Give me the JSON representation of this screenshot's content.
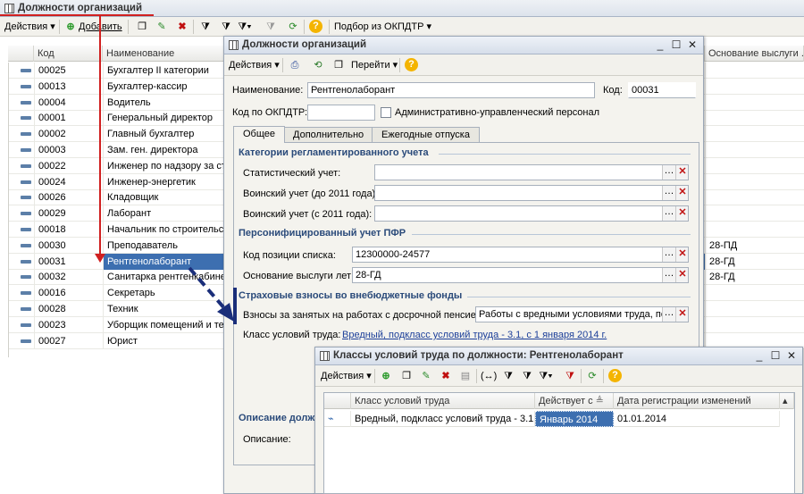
{
  "main": {
    "title": "Должности организаций",
    "toolbar": {
      "actions": "Действия",
      "add": "Добавить",
      "okpdtr": "Подбор из ОКПДТР"
    },
    "columns": {
      "code": "Код",
      "name": "Наименование",
      "seniority": "Основание выслуги ..."
    },
    "rows": [
      {
        "code": "00025",
        "name": "Бухгалтер II категории",
        "seniority": ""
      },
      {
        "code": "00013",
        "name": "Бухгалтер-кассир",
        "seniority": ""
      },
      {
        "code": "00004",
        "name": "Водитель",
        "seniority": ""
      },
      {
        "code": "00001",
        "name": "Генеральный директор",
        "seniority": ""
      },
      {
        "code": "00002",
        "name": "Главный бухгалтер",
        "seniority": ""
      },
      {
        "code": "00003",
        "name": "Зам. ген. директора",
        "seniority": ""
      },
      {
        "code": "00022",
        "name": "Инженер по надзору за стр",
        "seniority": ""
      },
      {
        "code": "00024",
        "name": "Инженер-энергетик",
        "seniority": ""
      },
      {
        "code": "00026",
        "name": "Кладовщик",
        "seniority": ""
      },
      {
        "code": "00029",
        "name": "Лаборант",
        "seniority": ""
      },
      {
        "code": "00018",
        "name": "Начальник по строительст",
        "seniority": ""
      },
      {
        "code": "00030",
        "name": "Преподаватель",
        "seniority": "28-ПД"
      },
      {
        "code": "00031",
        "name": "Рентгенолаборант",
        "seniority": "28-ГД"
      },
      {
        "code": "00032",
        "name": "Санитарка рентгенкабинет",
        "seniority": "28-ГД"
      },
      {
        "code": "00016",
        "name": "Секретарь",
        "seniority": ""
      },
      {
        "code": "00028",
        "name": "Техник",
        "seniority": ""
      },
      {
        "code": "00023",
        "name": "Уборщик помещений и тер",
        "seniority": ""
      },
      {
        "code": "00027",
        "name": "Юрист",
        "seniority": ""
      }
    ]
  },
  "form": {
    "title": "Должности организаций",
    "toolbar": {
      "actions": "Действия",
      "goto": "Перейти"
    },
    "name_label": "Наименование:",
    "name_value": "Рентгенолаборант",
    "code_label": "Код:",
    "code_value": "00031",
    "okpdtr_label": "Код по ОКПДТР:",
    "okpdtr_value": "",
    "admin_label": "Административно-управленческий персонал",
    "tabs": [
      "Общее",
      "Дополнительно",
      "Ежегодные отпуска"
    ],
    "section1": "Категории регламентированного учета",
    "stat_label": "Статистический учет:",
    "mil1_label": "Воинский учет (до 2011 года):",
    "mil2_label": "Воинский учет (с 2011 года):",
    "section2": "Персонифицированный учет ПФР",
    "pos_code_label": "Код позиции списка:",
    "pos_code_value": "12300000-24577",
    "seniority_label": "Основание выслуги лет:",
    "seniority_value": "28-ГД",
    "section3": "Страховые взносы во внебюджетные фонды",
    "early_label": "Взносы за занятых на работах с досрочной пенсией:",
    "early_value": "Работы с вредными условиями труда, подг",
    "class_label": "Класс условий труда:",
    "class_link": "Вредный, подкласс условий труда - 3.1, с 1 января 2014 г.",
    "section4": "Описание долж",
    "desc_label": "Описание:"
  },
  "classes": {
    "title": "Классы условий труда по должности: Рентгенолаборант",
    "toolbar": {
      "actions": "Действия"
    },
    "columns": {
      "cls": "Класс условий труда",
      "from": "Действует с",
      "reg": "Дата регистрации изменений"
    },
    "rows": [
      {
        "cls": "Вредный, подкласс условий труда - 3.1",
        "from": "Январь 2014",
        "reg": "01.01.2014"
      }
    ]
  },
  "colors": {
    "arrow": "#d02020",
    "dash_arrow": "#1a2e7a",
    "selection": "#3d6fb0",
    "section": "#2a4a7a"
  }
}
